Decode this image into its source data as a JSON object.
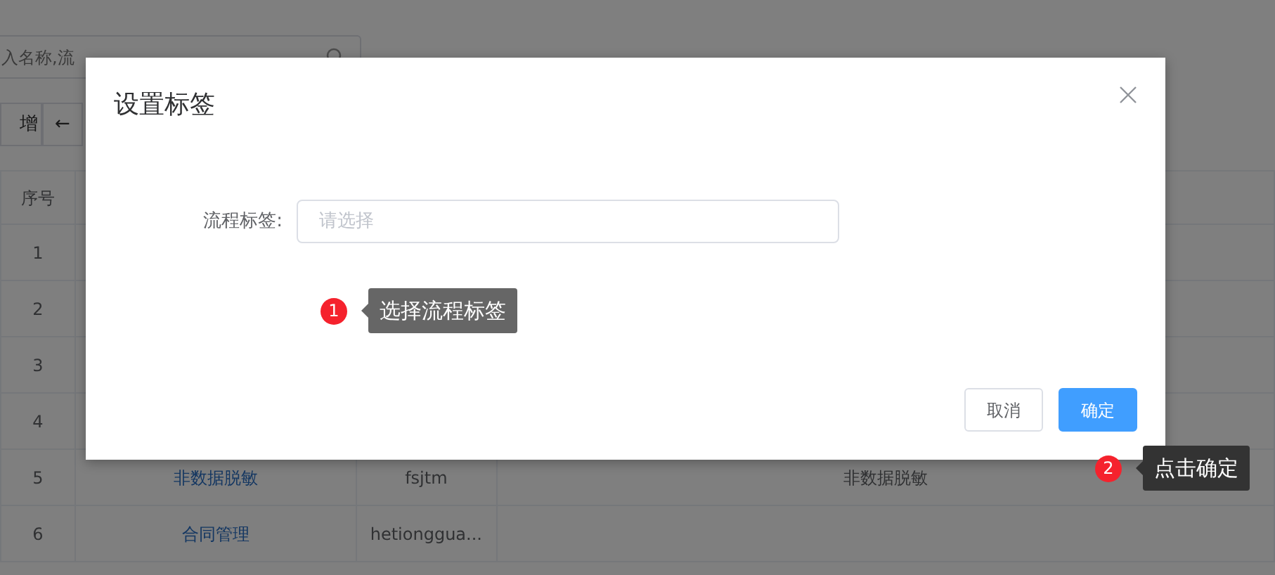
{
  "page": {
    "search": {
      "placeholder": "入名称,流"
    },
    "toolbar": [
      {
        "label": "增"
      },
      {
        "label": "←"
      }
    ],
    "table": {
      "columns": [
        "序号"
      ],
      "rows": [
        {
          "index": "1"
        },
        {
          "index": "2"
        },
        {
          "index": "3"
        },
        {
          "index": "4"
        },
        {
          "index": "5",
          "name": "非数据脱敏",
          "key": "fsjtm",
          "description": "非数据脱敏"
        },
        {
          "index": "6",
          "name": "合同管理",
          "key": "hetionggua..."
        }
      ]
    }
  },
  "modal": {
    "title": "设置标签",
    "field": {
      "label": "流程标签:",
      "placeholder": "请选择"
    },
    "buttons": [
      {
        "label": "取消",
        "kind": "default"
      },
      {
        "label": "确定",
        "kind": "primary"
      }
    ]
  },
  "guides": [
    {
      "number": "1",
      "text": "选择流程标签"
    },
    {
      "number": "2",
      "text": "点击确定"
    }
  ]
}
